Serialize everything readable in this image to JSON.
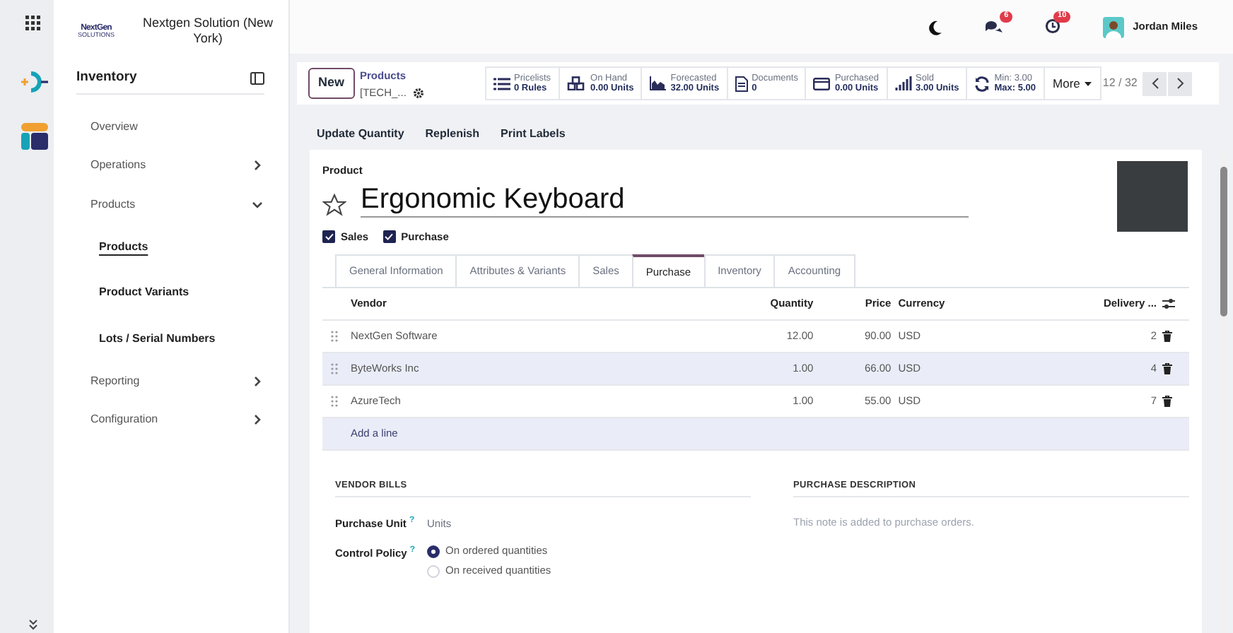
{
  "company": {
    "logo_text": "NextGen",
    "logo_subtext": "SOLUTIONS",
    "name": "Nextgen Solution (New York)"
  },
  "sidebar": {
    "title": "Inventory",
    "items": [
      {
        "label": "Overview"
      },
      {
        "label": "Operations",
        "expanded": false
      },
      {
        "label": "Products",
        "expanded": true,
        "children": [
          {
            "label": "Products",
            "selected": true
          },
          {
            "label": "Product Variants",
            "selected": false
          },
          {
            "label": "Lots / Serial Numbers",
            "selected": false
          }
        ]
      },
      {
        "label": "Reporting",
        "expanded": false
      },
      {
        "label": "Configuration",
        "expanded": false
      }
    ]
  },
  "topbar": {
    "chat_badge": "6",
    "activity_badge": "10",
    "user": "Jordan Miles"
  },
  "control_panel": {
    "new_button": "New",
    "breadcrumb": "Products",
    "record": "[TECH_...",
    "stats": [
      {
        "kind": "list",
        "title": "Pricelists",
        "value": "0 Rules"
      },
      {
        "kind": "cubes",
        "title": "On Hand",
        "value": "0.00 Units"
      },
      {
        "kind": "area",
        "title": "Forecasted",
        "value": "32.00 Units"
      },
      {
        "kind": "doc",
        "title": "Documents",
        "value": "0"
      },
      {
        "kind": "card",
        "title": "Purchased",
        "value": "0.00 Units"
      },
      {
        "kind": "bars",
        "title": "Sold",
        "value": "3.00 Units"
      },
      {
        "kind": "refresh",
        "title": "Min: 3.00",
        "value": "Max: 5.00"
      }
    ],
    "more": "More",
    "pager": "12 / 32"
  },
  "actions": [
    "Update Quantity",
    "Replenish",
    "Print Labels"
  ],
  "form": {
    "label": "Product",
    "name": "Ergonomic Keyboard",
    "starred": false,
    "options": [
      {
        "label": "Sales",
        "checked": true
      },
      {
        "label": "Purchase",
        "checked": true
      }
    ],
    "tabs": [
      {
        "label": "General Information",
        "selected": false
      },
      {
        "label": "Attributes & Variants",
        "selected": false
      },
      {
        "label": "Sales",
        "selected": false
      },
      {
        "label": "Purchase",
        "selected": true
      },
      {
        "label": "Inventory",
        "selected": false
      },
      {
        "label": "Accounting",
        "selected": false
      }
    ],
    "table": {
      "columns": [
        "Vendor",
        "Quantity",
        "Price",
        "Currency",
        "Delivery ..."
      ],
      "rows": [
        [
          "NextGen Software",
          "12.00",
          "90.00",
          "USD",
          "2"
        ],
        [
          "ByteWorks Inc",
          "1.00",
          "66.00",
          "USD",
          "4"
        ],
        [
          "AzureTech",
          "1.00",
          "55.00",
          "USD",
          "7"
        ]
      ],
      "add_line": "Add a line"
    },
    "vendor_bills": {
      "heading": "VENDOR BILLS",
      "unit_label": "Purchase Unit",
      "unit_help": "?",
      "unit_value": "Units",
      "policy_label": "Control Policy",
      "policy_help": "?",
      "policies": [
        {
          "label": "On ordered quantities",
          "selected": true
        },
        {
          "label": "On received quantities",
          "selected": false
        }
      ]
    },
    "description": {
      "heading": "PURCHASE DESCRIPTION",
      "placeholder": "This note is added to purchase orders."
    }
  }
}
